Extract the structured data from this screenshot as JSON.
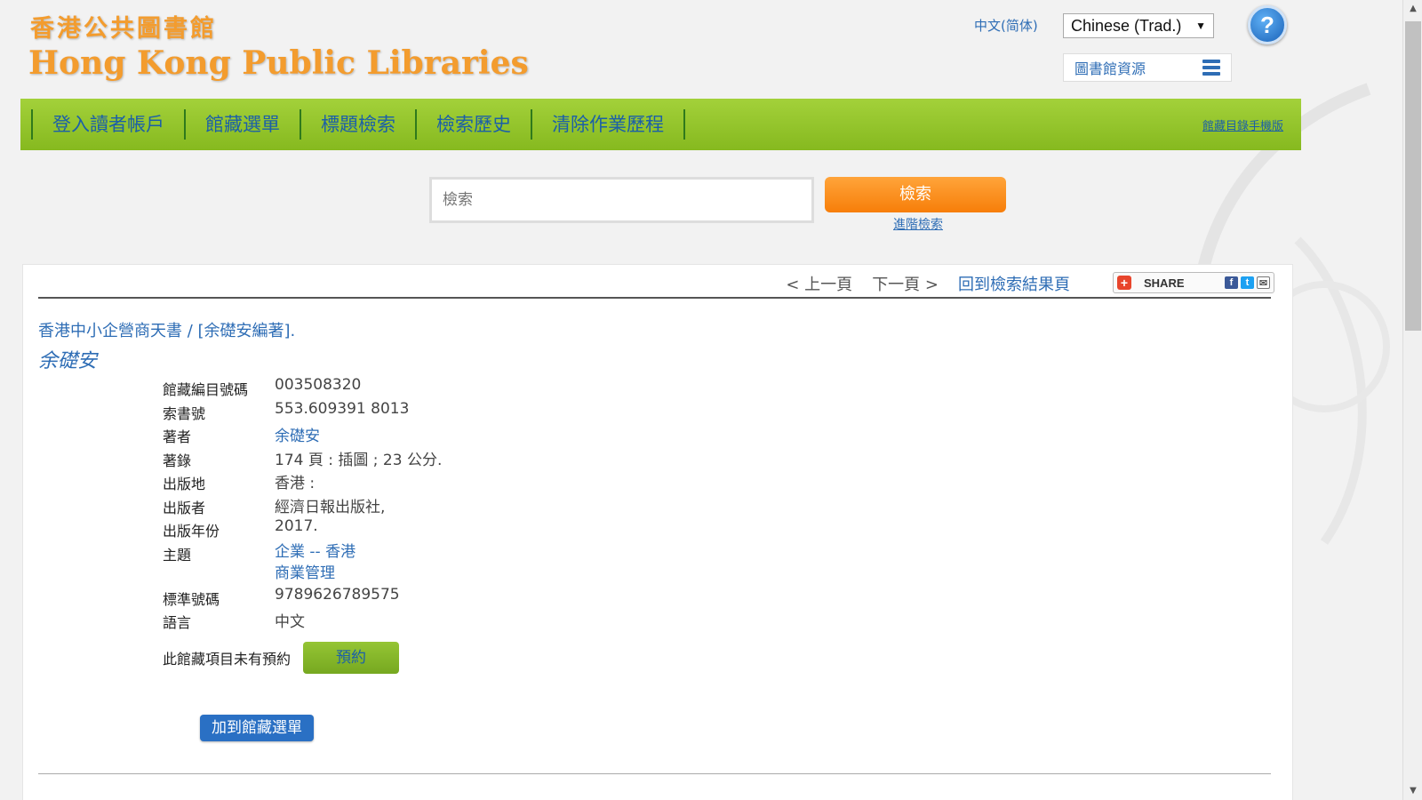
{
  "header": {
    "logo_zh": "香港公共圖書館",
    "logo_en": "Hong Kong Public Libraries",
    "lang_link": "中文(简体)",
    "lang_select": "Chinese (Trad.)",
    "help_label": "?",
    "resources_label": "圖書館資源"
  },
  "nav": {
    "items": [
      "登入讀者帳戶",
      "館藏選單",
      "標題檢索",
      "檢索歷史",
      "清除作業歷程"
    ],
    "mobile_link": "館藏目錄手機版"
  },
  "search": {
    "placeholder": "檢索",
    "button": "檢索",
    "advanced": "進階檢索"
  },
  "pager": {
    "prev": "< 上一頁",
    "next": "下一頁 >",
    "back": "回到檢索結果頁",
    "share": "SHARE"
  },
  "record": {
    "title": "香港中小企營商天書 / [余礎安編著].",
    "author": "余礎安",
    "fields": [
      {
        "label": "館藏編目號碼",
        "value": "003508320"
      },
      {
        "label": "索書號",
        "value": "553.609391 8013"
      },
      {
        "label": "著者",
        "value": "余礎安"
      },
      {
        "label": "著錄",
        "value": "174 頁 : 插圖 ; 23 公分."
      },
      {
        "label": "出版地",
        "value": "香港 :"
      },
      {
        "label": "出版者",
        "value": "經濟日報出版社,"
      },
      {
        "label": "出版年份",
        "value": "2017."
      },
      {
        "label": "主題",
        "value": "企業",
        "sep": "--",
        "value2": "香港",
        "value3": "商業管理"
      },
      {
        "label": "標準號碼",
        "value": "9789626789575"
      },
      {
        "label": "語言",
        "value": "中文"
      }
    ],
    "reserve_label": "此館藏項目未有預約",
    "reserve_button": "預約",
    "add_list_button": "加到館藏選單"
  },
  "colors": {
    "accent_orange": "#f77e09",
    "nav_green": "#86b91f",
    "link_blue": "#2e6db5"
  }
}
